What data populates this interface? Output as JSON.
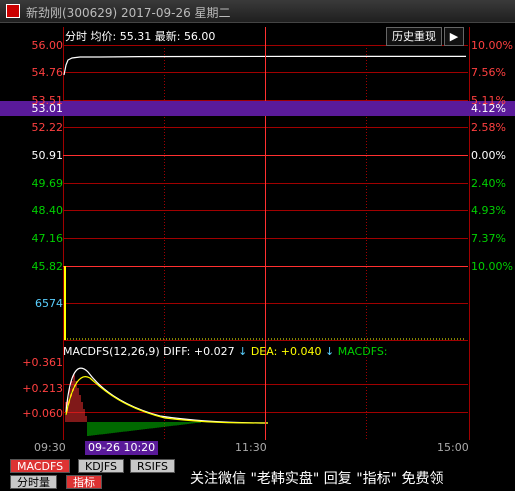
{
  "window": {
    "title": "新劲刚(300629) 2017-09-26 星期二"
  },
  "infobar": {
    "label": "分时",
    "avg_label": "均价:",
    "avg_value": "55.31",
    "latest_label": "最新:",
    "latest_value": "56.00",
    "history_button": "历史重现",
    "expand_icon": "▶"
  },
  "price_axis": {
    "left": [
      "56.00",
      "54.76",
      "53.51",
      "53.01",
      "52.22",
      "50.91",
      "49.69",
      "48.40",
      "47.16",
      "45.82"
    ],
    "right": [
      "10.00%",
      "7.56%",
      "5.11%",
      "4.12%",
      "2.58%",
      "0.00%",
      "2.40%",
      "4.93%",
      "7.37%",
      "10.00%"
    ]
  },
  "volume_axis": {
    "left": "6574"
  },
  "macd": {
    "title": "MACDFS(12,26,9)",
    "diff": "DIFF: +0.027",
    "dea": "DEA: +0.040",
    "name": "MACDFS:",
    "axis": [
      "+0.361",
      "+0.213",
      "+0.060"
    ],
    "arrow_icon": "↓"
  },
  "time_axis": {
    "start": "09:30",
    "mid": "11:30",
    "end": "15:00",
    "cursor": "09-26 10:20"
  },
  "tabs": [
    {
      "label": "MACDFS",
      "active": true
    },
    {
      "label": "KDJFS",
      "active": false
    },
    {
      "label": "RSIFS",
      "active": false
    }
  ],
  "bottom_tabs": [
    {
      "label": "分时量",
      "active": false
    },
    {
      "label": "指标",
      "active": true
    }
  ],
  "watermark": "关注微信 \"老韩实盘\" 回复 \"指标\" 免费领",
  "colors": {
    "up": "#ff3232",
    "down": "#00d000",
    "neutral": "#ffffff",
    "grid": "#a00000",
    "accent": "#5a1a9a"
  }
}
